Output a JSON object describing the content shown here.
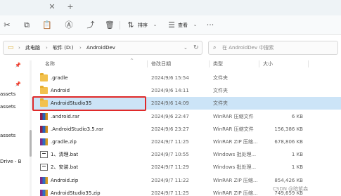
{
  "titlebar": {
    "buttons": [
      "close-icon",
      "add-icon"
    ]
  },
  "toolbar": {
    "sort_label": "排序",
    "view_label": "查看",
    "icons": [
      "cut-icon",
      "copy-icon",
      "paste-icon",
      "rename-icon",
      "share-icon",
      "delete-icon",
      "sort-icon",
      "view-icon",
      "more-icon"
    ]
  },
  "address": {
    "crumbs": [
      "此电脑",
      "软件 (D:)",
      "AndroidDev"
    ]
  },
  "search": {
    "placeholder": "在 AndroidDev 中搜索"
  },
  "left_pane": {
    "items": [
      "assets",
      "assets",
      "assets",
      "Drive - B"
    ]
  },
  "columns": {
    "name": "名称",
    "date": "修改日期",
    "type": "类型",
    "size": "大小"
  },
  "files": [
    {
      "name": ".gradle",
      "date": "2024/9/6 15:54",
      "type": "文件夹",
      "size": "",
      "icon": "folder-icon"
    },
    {
      "name": "Android",
      "date": "2024/9/6 14:11",
      "type": "文件夹",
      "size": "",
      "icon": "folder-icon"
    },
    {
      "name": "AndroidStudio35",
      "date": "2024/9/6 14:09",
      "type": "文件夹",
      "size": "",
      "icon": "folder-icon"
    },
    {
      "name": ".android.rar",
      "date": "2024/9/6 22:47",
      "type": "WinRAR 压缩文件",
      "size": "6 KB",
      "icon": "rar-icon"
    },
    {
      "name": ".AndroidStudio3.5.rar",
      "date": "2024/9/6 23:27",
      "type": "WinRAR 压缩文件",
      "size": "156,386 KB",
      "icon": "rar-icon"
    },
    {
      "name": ".gradle.zip",
      "date": "2024/9/7 11:25",
      "type": "WinRAR ZIP 压缩...",
      "size": "678,806 KB",
      "icon": "zip-icon"
    },
    {
      "name": "1、清理.bat",
      "date": "2024/9/7 10:55",
      "type": "Windows 批处理...",
      "size": "1 KB",
      "icon": "bat-icon"
    },
    {
      "name": "2、安装.bat",
      "date": "2024/9/7 11:29",
      "type": "Windows 批处理...",
      "size": "1 KB",
      "icon": "bat-icon"
    },
    {
      "name": "Android.zip",
      "date": "2024/9/7 11:22",
      "type": "WinRAR ZIP 压缩...",
      "size": "854,426 KB",
      "icon": "zip-icon"
    },
    {
      "name": "AndroidStudio35.zip",
      "date": "2024/9/7 11:25",
      "type": "WinRAR ZIP 压缩...",
      "size": "749,659 KB",
      "icon": "zip-icon"
    }
  ],
  "selected_index": 2,
  "watermark": "CSDN @暗紫森"
}
